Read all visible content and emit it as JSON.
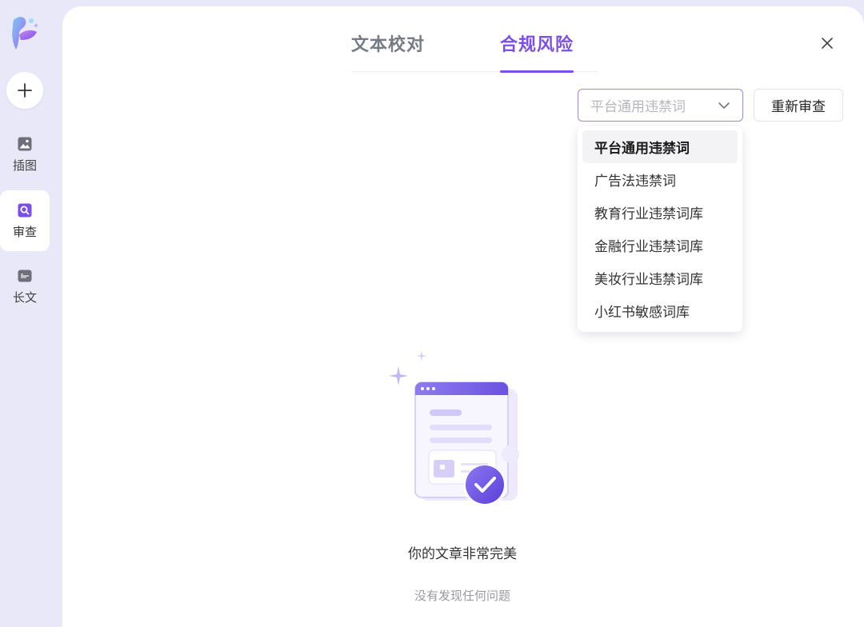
{
  "sidebar": {
    "items": [
      {
        "label": "插图",
        "icon": "image-icon"
      },
      {
        "label": "审查",
        "icon": "review-search-icon",
        "active": true
      },
      {
        "label": "长文",
        "icon": "long-article-icon"
      }
    ]
  },
  "tabs": [
    {
      "label": "文本校对"
    },
    {
      "label": "合规风险",
      "active": true
    }
  ],
  "select": {
    "value": "平台通用违禁词",
    "options": [
      "平台通用违禁词",
      "广告法违禁词",
      "教育行业违禁词库",
      "金融行业违禁词库",
      "美妆行业违禁词库",
      "小红书敏感词库"
    ]
  },
  "recheck": {
    "label": "重新审查"
  },
  "empty": {
    "title": "你的文章非常完美",
    "subtitle": "没有发现任何问题"
  },
  "colors": {
    "accent": "#7b4fe8",
    "sidebar_bg": "#e8e8f8",
    "panel_bg": "#ffffff"
  }
}
